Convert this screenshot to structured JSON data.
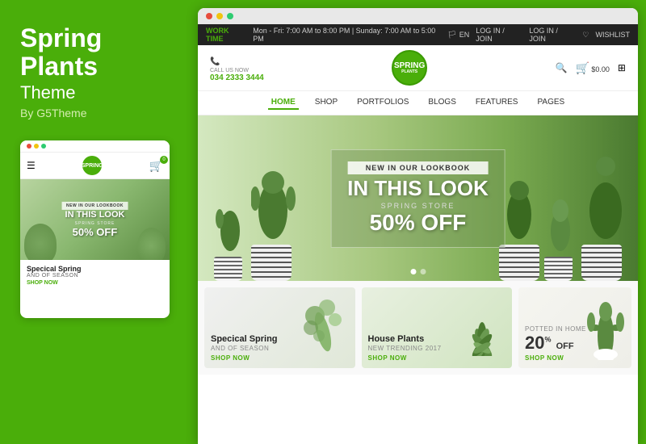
{
  "left": {
    "title": "Spring Plants",
    "subtitle": "Theme",
    "by": "By G5Theme"
  },
  "mobile": {
    "dots": [
      "red",
      "yellow",
      "green"
    ],
    "logo_text": "SPRING",
    "cart_count": "0",
    "hero_badge": "NEW IN OUR LOOKBOOK",
    "hero_main": "IN THIS LOOK",
    "hero_store": "SPRING STORE",
    "hero_off": "50% OFF",
    "product_title": "Specical Spring",
    "product_sub": "AND OF SEASON",
    "shop_now": "SHOP NOW"
  },
  "browser": {
    "dots": [
      "red",
      "yellow",
      "green"
    ]
  },
  "topbar": {
    "label": "WORK TIME",
    "hours": "Mon - Fri: 7:00 AM to 8:00 PM  |  Sunday: 7:00 AM to 5:00 PM",
    "lang": "EN",
    "login": "LOG IN / JOIN",
    "wishlist": "WISHLIST"
  },
  "header": {
    "call_label": "CALL US NOW",
    "phone": "034 2333 3444",
    "logo_line1": "SPRING",
    "logo_line2": "PLANTS",
    "cart_amount": "$0.00"
  },
  "nav": {
    "items": [
      {
        "label": "HOME",
        "active": true
      },
      {
        "label": "SHOP",
        "active": false
      },
      {
        "label": "PORTFOLIOS",
        "active": false
      },
      {
        "label": "BLOGS",
        "active": false
      },
      {
        "label": "FEATURES",
        "active": false
      },
      {
        "label": "PAGES",
        "active": false
      }
    ]
  },
  "hero": {
    "badge": "NEW IN OUR LOOKBOOK",
    "title": "IN THIS LOOK",
    "store": "SPRING STORE",
    "off": "50",
    "off_suffix": "% OFF"
  },
  "featured": [
    {
      "title": "Specical Spring",
      "sub": "AND OF SEASON",
      "link": "SHOP NOW"
    },
    {
      "title": "House Plants",
      "sub": "New Trending 2017",
      "link": "SHOP NOW"
    },
    {
      "percent": "20",
      "sup": "%",
      "off": "OFF",
      "label": "POTTED IN HOME",
      "link": "SHOP NOW"
    }
  ]
}
